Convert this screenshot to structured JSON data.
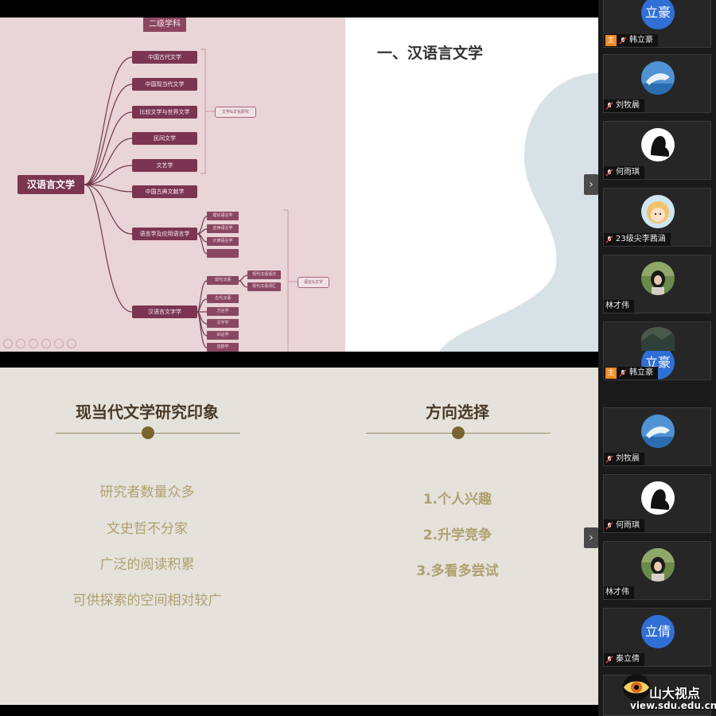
{
  "mindmap": {
    "top_label": "二级学科",
    "root": "汉语言文学",
    "branches": [
      "中国古代文学",
      "中国现当代文学",
      "比较文学与世界文学",
      "民间文学",
      "文艺学",
      "中国古典文献学",
      "语言学及应用语言学",
      "汉语言文字学"
    ],
    "notes": [
      "文学&文化研究",
      "语言&文字"
    ],
    "leaves_linguistics": [
      "理论语言学",
      "应用语言学",
      "计算语言学"
    ],
    "leaves_chinese": [
      "现代汉语",
      "古代汉语",
      "方言学",
      "文字学",
      "训诂学",
      "音韵学",
      "中国语言学史"
    ],
    "leaves_chinese_sub": [
      "现代汉语语法",
      "现代汉语词汇"
    ]
  },
  "slide_top": {
    "heading": "一、汉语言文学"
  },
  "slide_bottom": {
    "left": {
      "title": "现当代文学研究印象",
      "items": [
        "研究者数量众多",
        "文史哲不分家",
        "广泛的阅读积累",
        "可供探索的空间相对较广"
      ]
    },
    "right": {
      "title": "方向选择",
      "items": [
        "1.个人兴趣",
        "2.升学竞争",
        "3.多看多尝试"
      ]
    }
  },
  "nav": {
    "arrow": "›"
  },
  "participants": [
    {
      "name": "韩立豪",
      "avatar_text": "立豪",
      "host": true
    },
    {
      "name": "刘牧晨",
      "avatar_icon": "whale-avatar"
    },
    {
      "name": "何雨琪",
      "avatar_icon": "silhouette-avatar"
    },
    {
      "name": "23级尖李茜涵",
      "avatar_icon": "cartoon-girl-avatar"
    },
    {
      "name": "林才伟",
      "avatar_icon": "photo-avatar"
    },
    {
      "name": "韩立豪",
      "avatar_text": "立豪",
      "host": true
    },
    {
      "name": "刘牧晨",
      "avatar_icon": "whale-avatar"
    },
    {
      "name": "何雨琪",
      "avatar_icon": "silhouette-avatar"
    },
    {
      "name": "林才伟",
      "avatar_icon": "photo-avatar"
    },
    {
      "name": "秦立倩",
      "avatar_text": "立倩"
    }
  ],
  "host_badge": "主",
  "brand": {
    "name": "山大视点",
    "url": "view.sdu.edu.cn"
  },
  "colors": {
    "accent_mindmap": "#7b3550",
    "avatar_blue": "#2f6fd6",
    "host_orange": "#f08a24"
  }
}
